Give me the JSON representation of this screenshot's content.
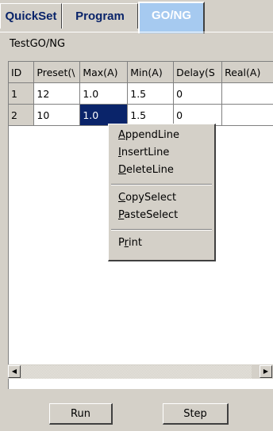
{
  "tabs": [
    {
      "label": "QuickSet",
      "active": false
    },
    {
      "label": "Program",
      "active": false
    },
    {
      "label": "GO/NG",
      "active": true
    }
  ],
  "group_label": "TestGO/NG",
  "grid": {
    "headers": [
      "ID",
      "Preset(\\",
      "Max(A)",
      "Min(A)",
      "Delay(S",
      "Real(A)"
    ],
    "rows": [
      [
        "1",
        "12",
        "1.0",
        "1.5",
        "0",
        ""
      ],
      [
        "2",
        "10",
        "1.0",
        "1.5",
        "0",
        ""
      ]
    ],
    "selected_cell": {
      "row": 2,
      "column": "Max(A)"
    }
  },
  "context_menu": {
    "items": [
      {
        "prefix": "",
        "accel": "A",
        "rest": "ppendLine"
      },
      {
        "prefix": "",
        "accel": "I",
        "rest": "nsertLine"
      },
      {
        "prefix": "",
        "accel": "D",
        "rest": "eleteLine"
      },
      {
        "separator": true
      },
      {
        "prefix": "",
        "accel": "C",
        "rest": "opySelect"
      },
      {
        "prefix": "",
        "accel": "P",
        "rest": "asteSelect"
      },
      {
        "separator": true
      },
      {
        "prefix": "P",
        "accel": "r",
        "rest": "int"
      }
    ]
  },
  "scrollbar": {
    "left_icon": "arrow-left-icon",
    "right_icon": "arrow-right-icon"
  },
  "buttons": {
    "run": "Run",
    "step": "Step"
  },
  "colors": {
    "face": "#d4d0c8",
    "active_tab": "#a6caf0",
    "selection": "#0a246a",
    "tab_text": "#0a246a"
  }
}
